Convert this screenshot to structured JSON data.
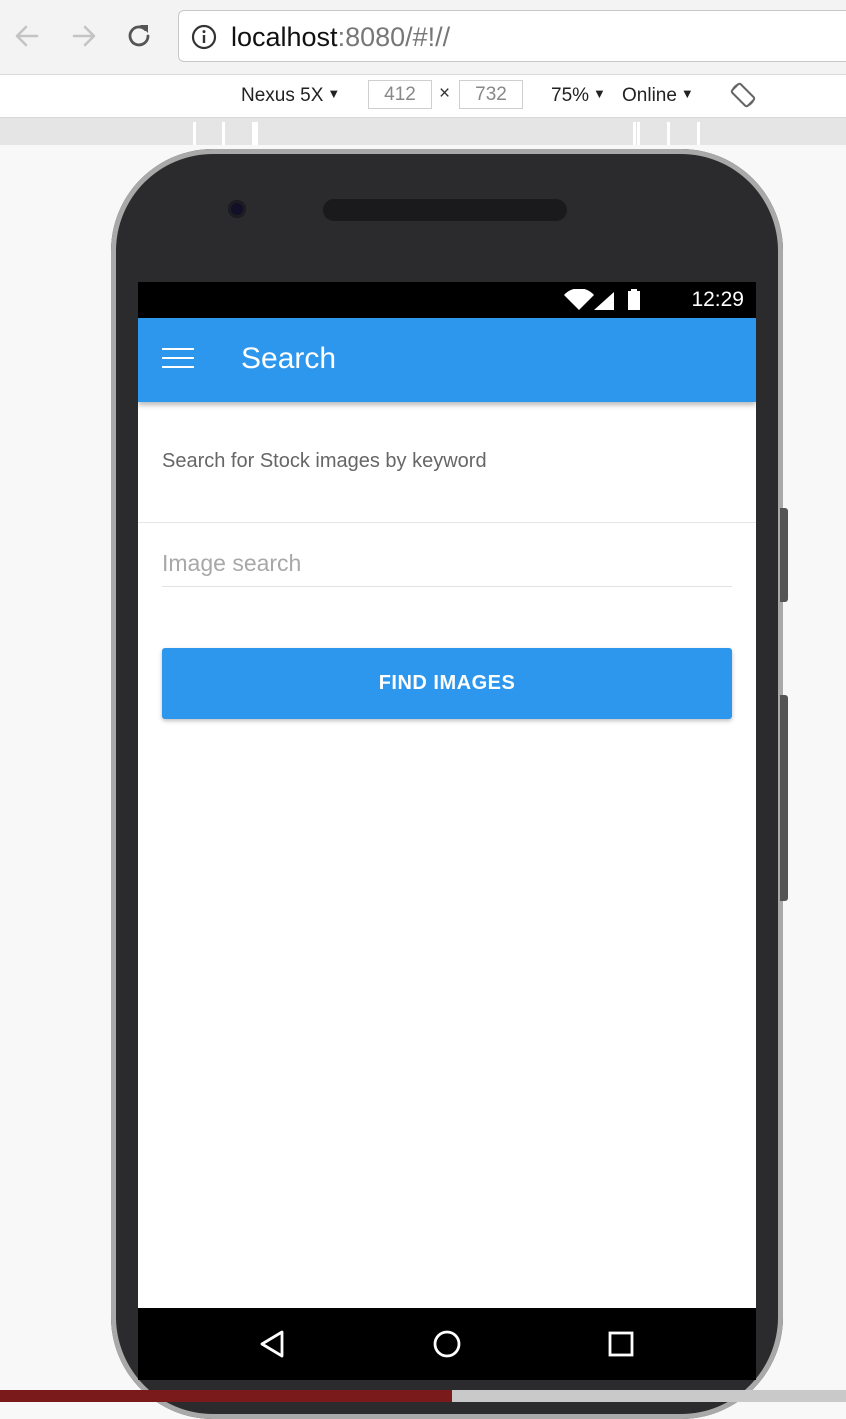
{
  "browser": {
    "url_host": "localhost",
    "url_rest": ":8080/#!//"
  },
  "devtools": {
    "device": "Nexus 5X",
    "width": "412",
    "height": "732",
    "times": "×",
    "zoom": "75%",
    "network": "Online"
  },
  "status_bar": {
    "time": "12:29"
  },
  "app_bar": {
    "title": "Search"
  },
  "content": {
    "intro": "Search for Stock images by keyword",
    "search_placeholder": "Image search",
    "search_value": "",
    "find_button": "FIND IMAGES"
  },
  "colors": {
    "primary": "#2d96ed",
    "phone_body": "#2b2a2c"
  }
}
